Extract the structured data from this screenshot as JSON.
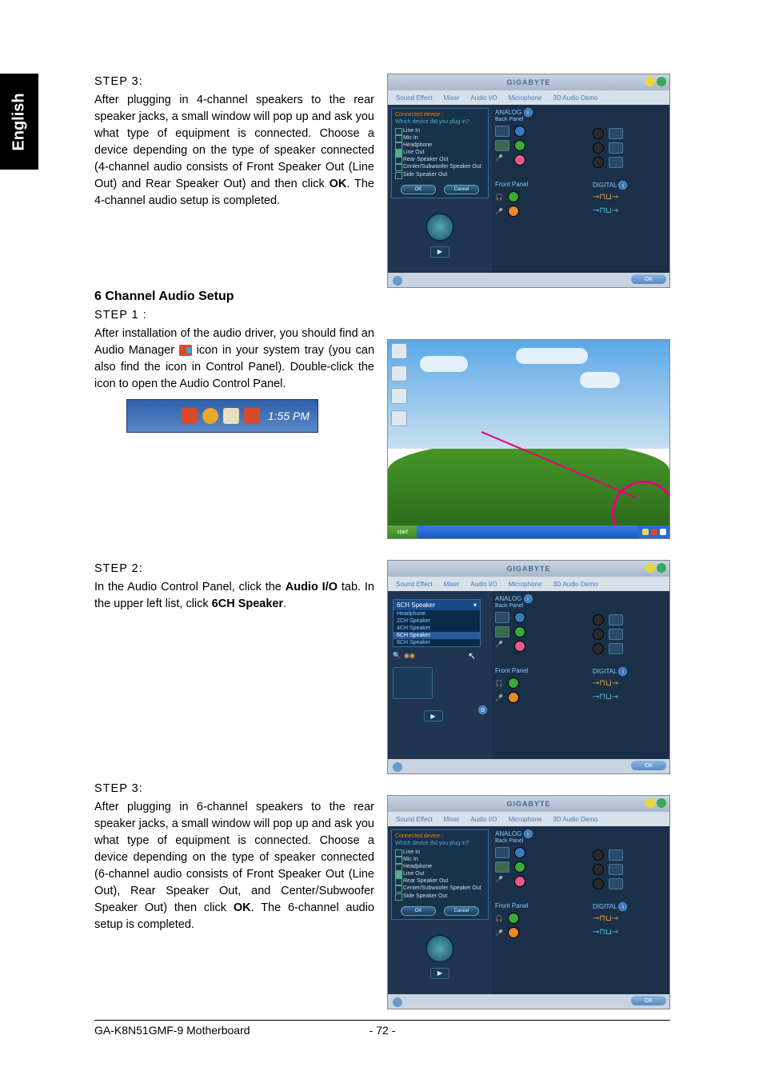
{
  "sideTab": "English",
  "step3a": {
    "label": "STEP 3:",
    "text": "After plugging in 4-channel speakers to the rear speaker jacks, a small window will pop up and ask you what type of equipment is connected. Choose a device depending on the type of speaker connected (4-channel audio consists of Front Speaker Out (Line Out) and Rear Speaker Out) and then click ",
    "bold1": "OK",
    "text2": ". The 4-channel audio setup is completed."
  },
  "heading6ch": "6 Channel Audio Setup",
  "step1": {
    "label": "STEP 1 :",
    "text1": "After installation of the audio driver, you should find an Audio Manager",
    "text2": " icon in your system tray (you can also find the icon in Control Panel).  Double-click the icon to open the Audio Control Panel."
  },
  "trayTime": "1:55 PM",
  "step2": {
    "label": "STEP 2:",
    "text1": "In the Audio Control Panel, click the ",
    "bold1": "Audio I/O",
    "text2": " tab. In the upper left list, click ",
    "bold2": "6CH Speaker",
    "text3": "."
  },
  "step3b": {
    "label": "STEP 3:",
    "text1": "After plugging in 6-channel speakers to the rear speaker jacks, a small window will pop up and ask you what type of equipment is connected. Choose a device depending on the type of speaker connected (6-channel audio consists of Front Speaker Out (Line Out), Rear Speaker Out, and Center/Subwoofer Speaker Out) then click ",
    "bold1": "OK",
    "text2": ". The 6-channel audio setup is completed."
  },
  "shot": {
    "logo": "GIGABYTE",
    "tabs": [
      "Sound Effect",
      "Mixer",
      "Audio I/O",
      "Microphone",
      "3D Audio Demo"
    ],
    "okBtn": "OK",
    "popupTitle": "Connected device :",
    "popupQ": "Which device did you plug in?",
    "devices": [
      "Line In",
      "Mic In",
      "Headphone",
      "Line Out",
      "Rear Speaker Out",
      "Center/Subwoofer Speaker Out",
      "Side Speaker Out"
    ],
    "popupOk": "OK",
    "popupCancel": "Cancel",
    "analog": "ANALOG",
    "backPanel": "Back Panel",
    "frontPanel": "Front Panel",
    "digital": "DIGITAL",
    "ddSelected": "6CH Speaker",
    "ddItems": [
      "Headphone",
      "2CH Speaker",
      "4CH Speaker",
      "6CH Speaker",
      "8CH Speaker"
    ]
  },
  "desktop": {
    "start": "start"
  },
  "footer": {
    "left": "GA-K8N51GMF-9 Motherboard",
    "page": "- 72 -"
  },
  "colors": {
    "blue": "#3a7aba",
    "green": "#3aaa3a",
    "pink": "#e85a8a",
    "orange": "#e88a2a",
    "black": "#2a2a2a",
    "grey": "#8a9aaa"
  }
}
